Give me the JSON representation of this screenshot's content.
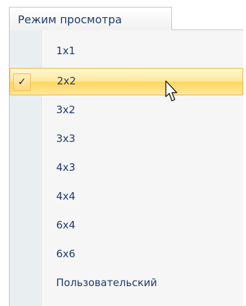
{
  "menu": {
    "title": "Режим просмотра",
    "check_symbol": "✓",
    "items": [
      {
        "label": "1x1",
        "selected": false
      },
      {
        "label": "2x2",
        "selected": true
      },
      {
        "label": "3x2",
        "selected": false
      },
      {
        "label": "3x3",
        "selected": false
      },
      {
        "label": "4x3",
        "selected": false
      },
      {
        "label": "4x4",
        "selected": false
      },
      {
        "label": "6x4",
        "selected": false
      },
      {
        "label": "6x6",
        "selected": false
      },
      {
        "label": "Пользовательский",
        "selected": false
      }
    ]
  },
  "colors": {
    "text": "#1f3a6b",
    "highlight_top": "#fff8d9",
    "highlight_bottom": "#ffd65c",
    "highlight_border": "#e7b93b",
    "gutter": "#e9eef1",
    "panel": "#f6f6f6"
  },
  "icons": {
    "cursor": "arrow-cursor-icon",
    "check": "check-icon"
  }
}
